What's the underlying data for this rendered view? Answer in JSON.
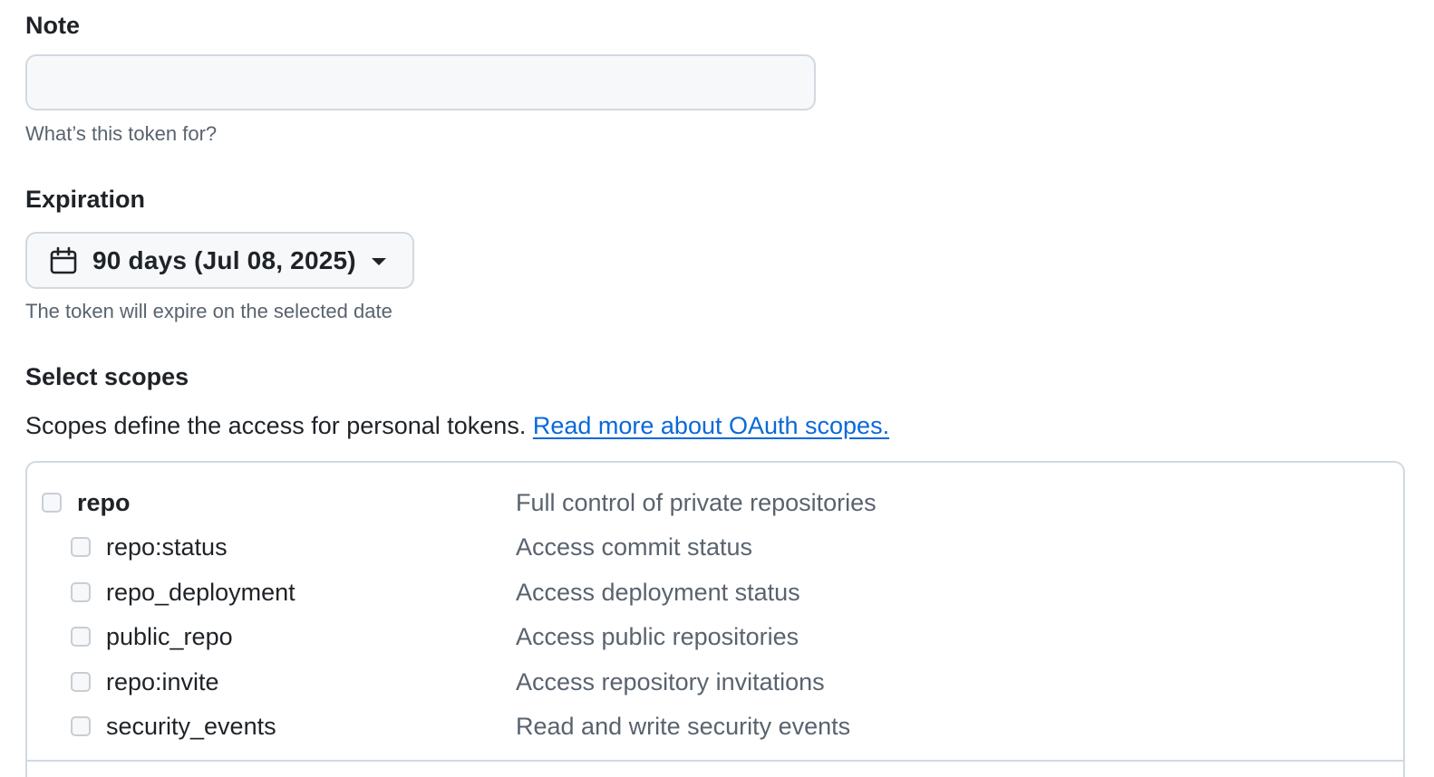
{
  "note": {
    "label": "Note",
    "value": "",
    "placeholder": "",
    "hint": "What’s this token for?"
  },
  "expiration": {
    "label": "Expiration",
    "selected": "90 days (Jul 08, 2025)",
    "hint": "The token will expire on the selected date",
    "icon": "calendar-icon"
  },
  "scopes": {
    "label": "Select scopes",
    "description": "Scopes define the access for personal tokens.",
    "link_text": "Read more about OAuth scopes.",
    "items": [
      {
        "name": "repo",
        "description": "Full control of private repositories",
        "checked": false,
        "parent": true
      },
      {
        "name": "repo:status",
        "description": "Access commit status",
        "checked": false,
        "parent": false
      },
      {
        "name": "repo_deployment",
        "description": "Access deployment status",
        "checked": false,
        "parent": false
      },
      {
        "name": "public_repo",
        "description": "Access public repositories",
        "checked": false,
        "parent": false
      },
      {
        "name": "repo:invite",
        "description": "Access repository invitations",
        "checked": false,
        "parent": false
      },
      {
        "name": "security_events",
        "description": "Read and write security events",
        "checked": false,
        "parent": false
      }
    ]
  },
  "colors": {
    "link": "#0969da",
    "text": "#1f2328",
    "muted": "#59636e",
    "border": "#d1d9e0",
    "input_bg": "#f6f8fa"
  }
}
